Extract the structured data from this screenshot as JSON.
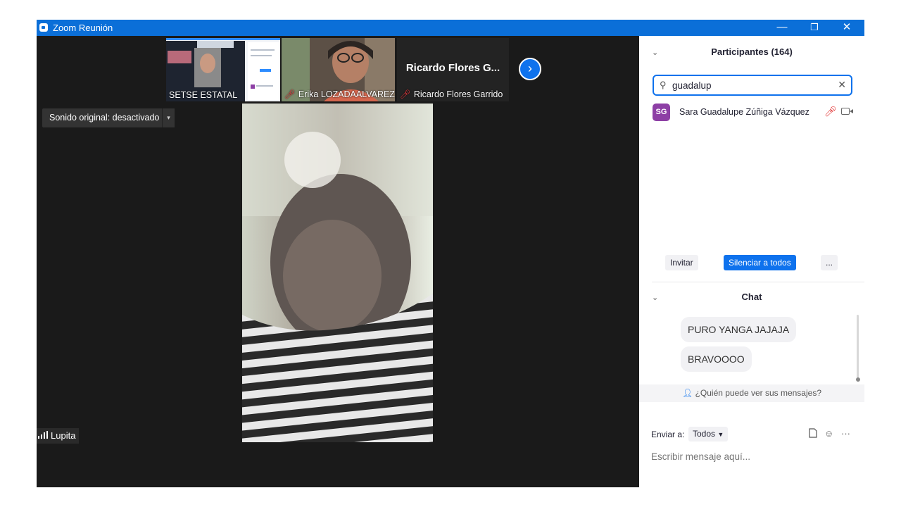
{
  "window": {
    "title": "Zoom Reunión",
    "controls": {
      "minimize": "—",
      "restore": "❐",
      "close": "✕"
    }
  },
  "gallery_strip": {
    "thumbnails": [
      {
        "label": "SETSE ESTATAL",
        "muted": false
      },
      {
        "label": "Erika LOZADAALVAREZ",
        "muted": true
      },
      {
        "label": "Ricardo Flores Garrido",
        "muted": true,
        "title": "Ricardo Flores G..."
      }
    ],
    "next_icon": "›"
  },
  "sound_button": {
    "label": "Sonido original: desactivado",
    "arrow": "▾"
  },
  "main_speaker": {
    "name": "Lupita"
  },
  "participants": {
    "header": "Participantes (164)",
    "search_value": "guadalup",
    "list": [
      {
        "initials": "SG",
        "name": "Sara Guadalupe Zúñiga Vázquez",
        "muted": true,
        "avatar_color": "#8d3fa5"
      }
    ],
    "buttons": {
      "invite": "Invitar",
      "mute_all": "Silenciar a todos",
      "more": "..."
    }
  },
  "chat": {
    "header": "Chat",
    "messages": [
      "PURO YANGA JAJAJA",
      "BRAVOOOO"
    ],
    "visibility_hint": "¿Quién puede ver sus mensajes?",
    "send_to_label": "Enviar a:",
    "send_to_value": "Todos",
    "input_placeholder": "Escribir mensaje aquí..."
  },
  "colors": {
    "titlebar": "#0b6fd8",
    "accent": "#0e72ed",
    "muted_red": "#e02828",
    "dark_bg": "#1a1a1a"
  }
}
